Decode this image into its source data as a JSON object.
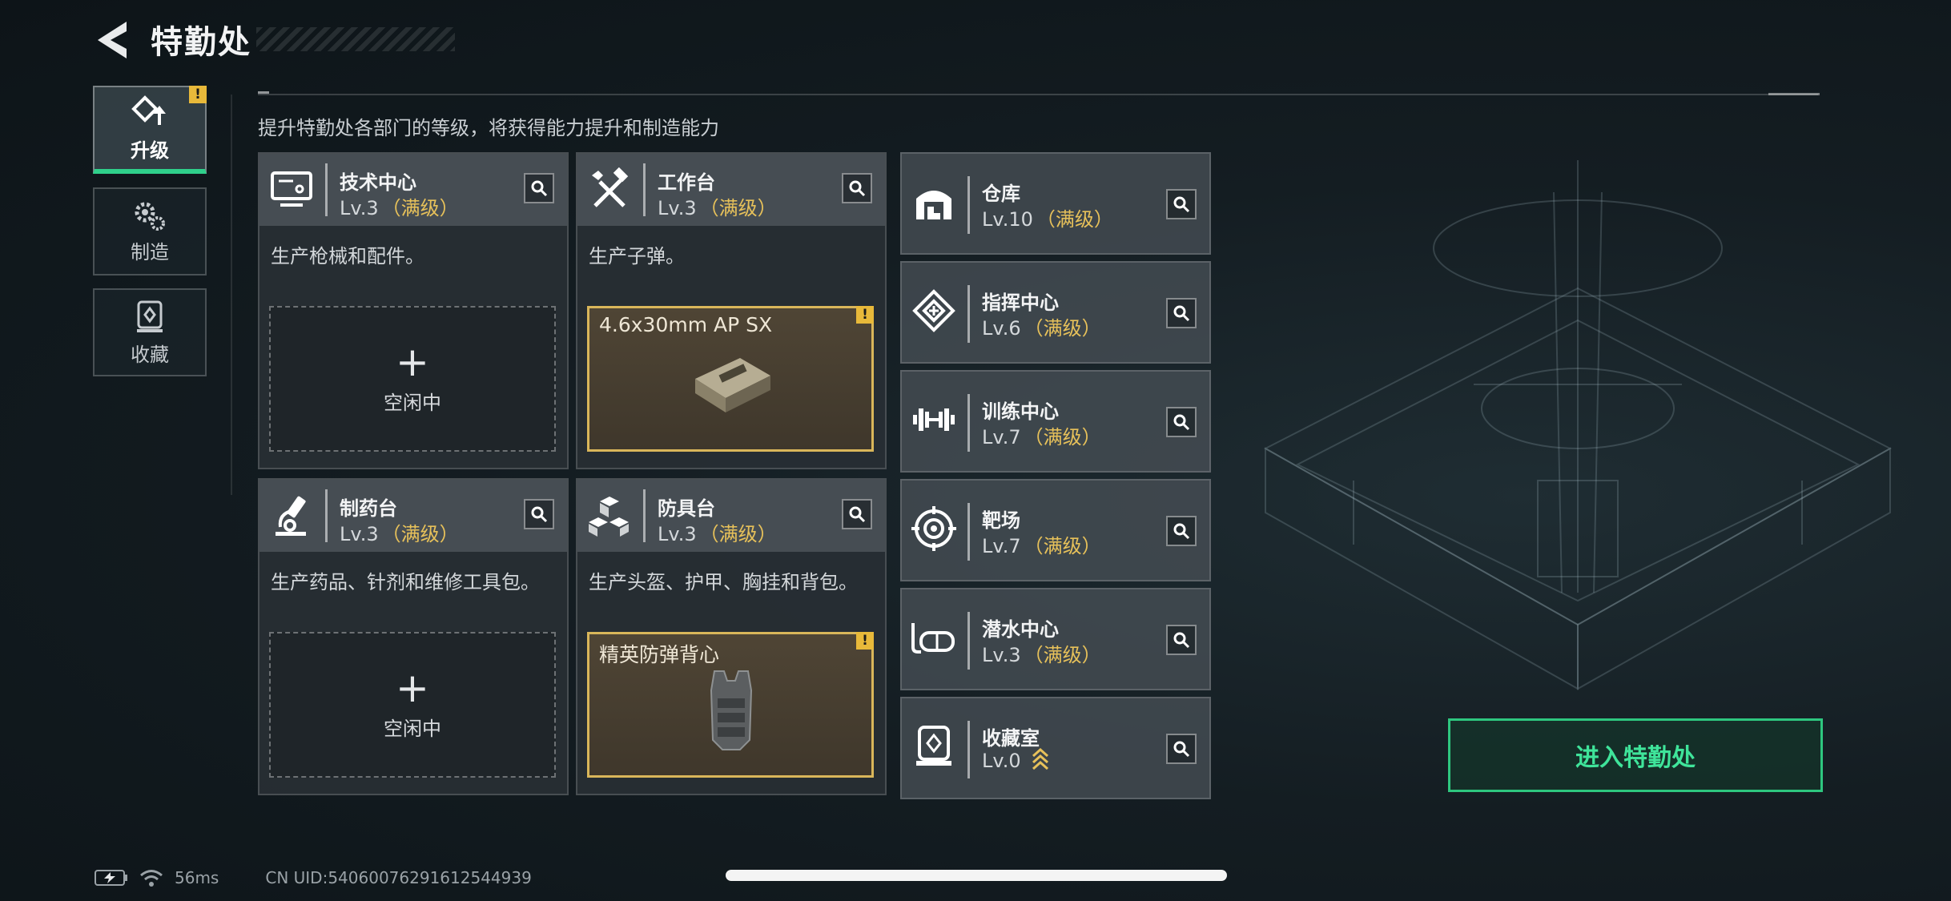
{
  "header": {
    "title": "特勤处"
  },
  "subtitle": "提升特勤处各部门的等级，将获得能力提升和制造能力",
  "nav": [
    {
      "label": "升级",
      "icon": "upgrade-icon",
      "active": true,
      "alert": "!"
    },
    {
      "label": "制造",
      "icon": "gears-icon",
      "active": false
    },
    {
      "label": "收藏",
      "icon": "collection-icon",
      "active": false
    }
  ],
  "departments": [
    {
      "name": "技术中心",
      "level": "Lv.3",
      "status": "（满级）",
      "desc": "生产枪械和配件。",
      "slot": {
        "type": "empty",
        "plus": "+",
        "label": "空闲中"
      },
      "icon": "monitor-icon"
    },
    {
      "name": "工作台",
      "level": "Lv.3",
      "status": "（满级）",
      "desc": "生产子弹。",
      "slot": {
        "type": "item",
        "label": "4.6x30mm AP SX",
        "alert": "!"
      },
      "icon": "tools-icon"
    },
    {
      "name": "制药台",
      "level": "Lv.3",
      "status": "（满级）",
      "desc": "生产药品、针剂和维修工具包。",
      "slot": {
        "type": "empty",
        "plus": "+",
        "label": "空闲中"
      },
      "icon": "microscope-icon"
    },
    {
      "name": "防具台",
      "level": "Lv.3",
      "status": "（满级）",
      "desc": "生产头盔、护甲、胸挂和背包。",
      "slot": {
        "type": "item",
        "label": "精英防弹背心",
        "alert": "!"
      },
      "icon": "cubes-icon"
    }
  ],
  "facilities": [
    {
      "name": "仓库",
      "level": "Lv.10",
      "status": "（满级）",
      "icon": "warehouse-icon"
    },
    {
      "name": "指挥中心",
      "level": "Lv.6",
      "status": "（满级）",
      "icon": "chip-icon"
    },
    {
      "name": "训练中心",
      "level": "Lv.7",
      "status": "（满级）",
      "icon": "dumbbell-icon"
    },
    {
      "name": "靶场",
      "level": "Lv.7",
      "status": "（满级）",
      "icon": "target-icon"
    },
    {
      "name": "潜水中心",
      "level": "Lv.3",
      "status": "（满级）",
      "icon": "diving-mask-icon"
    },
    {
      "name": "收藏室",
      "level": "Lv.0",
      "status": "",
      "icon": "display-case-icon",
      "upgradeable": true
    }
  ],
  "enter_button": "进入特勤处",
  "status_bar": {
    "ping": "56ms",
    "uid": "CN UID:54060076291612544939"
  },
  "colors": {
    "accent_green": "#2ec77f",
    "max_level_gold": "#e7c15a",
    "alert_yellow": "#e8b93a"
  }
}
